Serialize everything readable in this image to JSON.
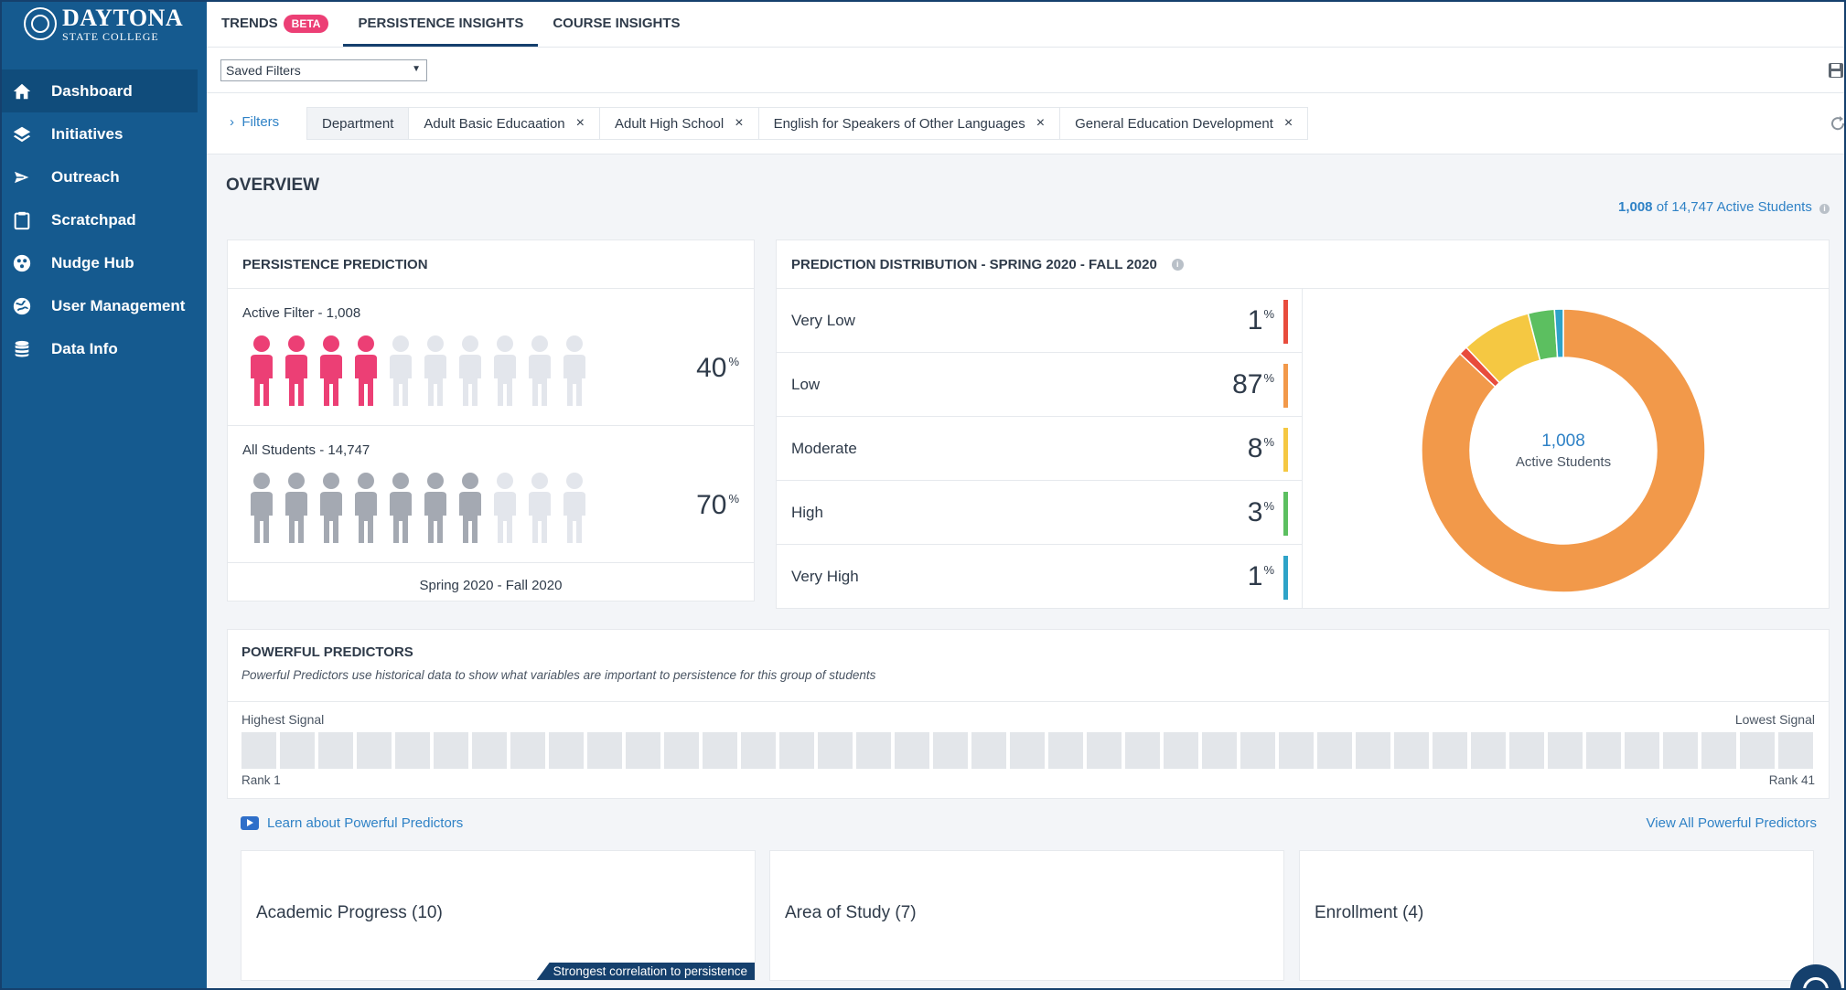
{
  "brand": {
    "line1": "DAYTONA",
    "line2": "STATE COLLEGE"
  },
  "sidebar": {
    "items": [
      {
        "label": "Dashboard",
        "icon": "home-icon"
      },
      {
        "label": "Initiatives",
        "icon": "layers-icon"
      },
      {
        "label": "Outreach",
        "icon": "send-icon"
      },
      {
        "label": "Scratchpad",
        "icon": "clipboard-icon"
      },
      {
        "label": "Nudge Hub",
        "icon": "hub-icon"
      },
      {
        "label": "User Management",
        "icon": "globe-icon"
      },
      {
        "label": "Data Info",
        "icon": "database-icon"
      }
    ]
  },
  "tabs": {
    "trends": "TRENDS",
    "beta": "BETA",
    "persistence": "PERSISTENCE INSIGHTS",
    "course": "COURSE INSIGHTS"
  },
  "saved_filters": {
    "value": "Saved Filters"
  },
  "filters": {
    "toggle": "Filters",
    "department": "Department",
    "chips": [
      "Adult Basic Educaation",
      "Adult High School",
      "English for Speakers of Other Languages",
      "General Education Development"
    ]
  },
  "overview": {
    "title": "OVERVIEW",
    "count": "1,008",
    "count_suffix": "of 14,747 Active Students"
  },
  "persistence": {
    "title": "PERSISTENCE PREDICTION",
    "active_label": "Active Filter - 1,008",
    "active_pct": "40",
    "all_label": "All Students - 14,747",
    "all_pct": "70",
    "pct_sign": "%",
    "term": "Spring 2020 - Fall 2020",
    "active_filled": 4,
    "all_filled": 7,
    "people_total": 10,
    "colors": {
      "active": "#ec3f75",
      "all": "#a4a9b2",
      "empty": "#e3e6ec"
    }
  },
  "distribution": {
    "title": "PREDICTION DISTRIBUTION - SPRING 2020 - FALL 2020",
    "rows": [
      {
        "label": "Very Low",
        "value": "1",
        "color": "#e84c3d"
      },
      {
        "label": "Low",
        "value": "87",
        "color": "#f2994a"
      },
      {
        "label": "Moderate",
        "value": "8",
        "color": "#f5c842"
      },
      {
        "label": "High",
        "value": "3",
        "color": "#5cbf60"
      },
      {
        "label": "Very High",
        "value": "1",
        "color": "#2ea3c8"
      }
    ],
    "pct_sign": "%",
    "donut_number": "1,008",
    "donut_label": "Active Students"
  },
  "predictors": {
    "title": "POWERFUL PREDICTORS",
    "subtitle": "Powerful Predictors use historical data to show what variables are important to persistence for this group of students",
    "highest": "Highest Signal",
    "lowest": "Lowest Signal",
    "rank_first": "Rank 1",
    "rank_last": "Rank 41",
    "squares": 41
  },
  "links": {
    "learn": "Learn about Powerful Predictors",
    "view_all": "View All Powerful Predictors"
  },
  "categories": [
    {
      "label": "Academic Progress (10)",
      "badge": "Strongest correlation to persistence"
    },
    {
      "label": "Area of Study (7)"
    },
    {
      "label": "Enrollment (4)"
    }
  ]
}
